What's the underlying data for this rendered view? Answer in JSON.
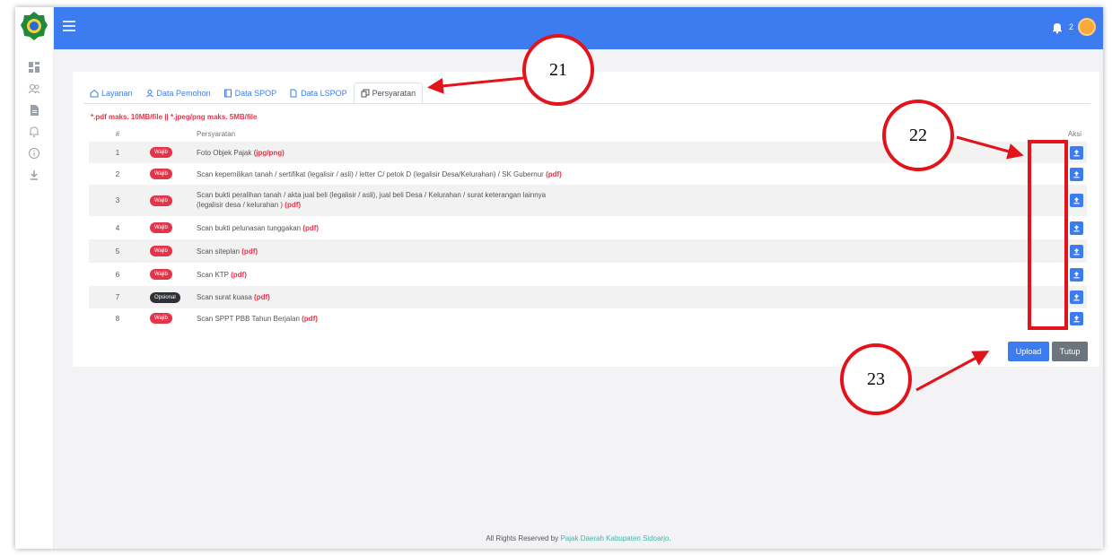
{
  "topbar": {
    "notification_count": "2"
  },
  "sidebar": {
    "icons": [
      "dashboard-icon",
      "users-icon",
      "document-icon",
      "bell-icon",
      "info-icon",
      "download-icon"
    ]
  },
  "tabs": [
    {
      "label": "Layanan",
      "icon": "home-icon"
    },
    {
      "label": "Data Pemohon",
      "icon": "user-icon"
    },
    {
      "label": "Data SPOP",
      "icon": "book-icon"
    },
    {
      "label": "Data LSPOP",
      "icon": "file-icon"
    },
    {
      "label": "Persyaratan",
      "icon": "copy-icon",
      "active": true
    }
  ],
  "note": "*.pdf maks. 10MB/file || *.jpeg/png maks. 5MB/file",
  "table": {
    "headers": {
      "num": "#",
      "requirement": "Persyaratan",
      "action": "Aksi"
    },
    "rows": [
      {
        "num": "1",
        "badge": "Wajib",
        "text": "Foto Objek Pajak",
        "format": "(jpg/png)"
      },
      {
        "num": "2",
        "badge": "Wajib",
        "text": "Scan kepemilikan tanah / sertifikat (legalisir / asli) / letter C/ petok D (legalisir Desa/Kelurahan) / SK Gubernur",
        "format": "(pdf)"
      },
      {
        "num": "3",
        "badge": "Wajib",
        "text": "Scan bukti peralihan tanah / akta jual beli (legalisir / asli), jual beli Desa / Kelurahan / surat keterangan lainnya",
        "text2": "(legalisir desa / kelurahan )",
        "format": "(pdf)"
      },
      {
        "num": "4",
        "badge": "Wajib",
        "text": "Scan bukti pelunasan tunggakan",
        "format": "(pdf)"
      },
      {
        "num": "5",
        "badge": "Wajib",
        "text": "Scan siteplan",
        "format": "(pdf)"
      },
      {
        "num": "6",
        "badge": "Wajib",
        "text": "Scan KTP",
        "format": "(pdf)"
      },
      {
        "num": "7",
        "badge": "Opsional",
        "text": "Scan surat kuasa",
        "format": "(pdf)"
      },
      {
        "num": "8",
        "badge": "Wajib",
        "text": "Scan SPPT PBB Tahun Berjalan",
        "format": "(pdf)"
      }
    ]
  },
  "buttons": {
    "upload": "Upload",
    "close": "Tutup"
  },
  "footer": {
    "prefix": "All Rights Reserved by ",
    "link": "Pajak Daerah Kabupaten Sidoarjo",
    "suffix": "."
  },
  "annotations": {
    "a21": "21",
    "a22": "22",
    "a23": "23"
  },
  "colors": {
    "primary": "#3d7cf0",
    "danger": "#e7334a",
    "dark": "#2f3338",
    "annotation": "#e3131b"
  }
}
